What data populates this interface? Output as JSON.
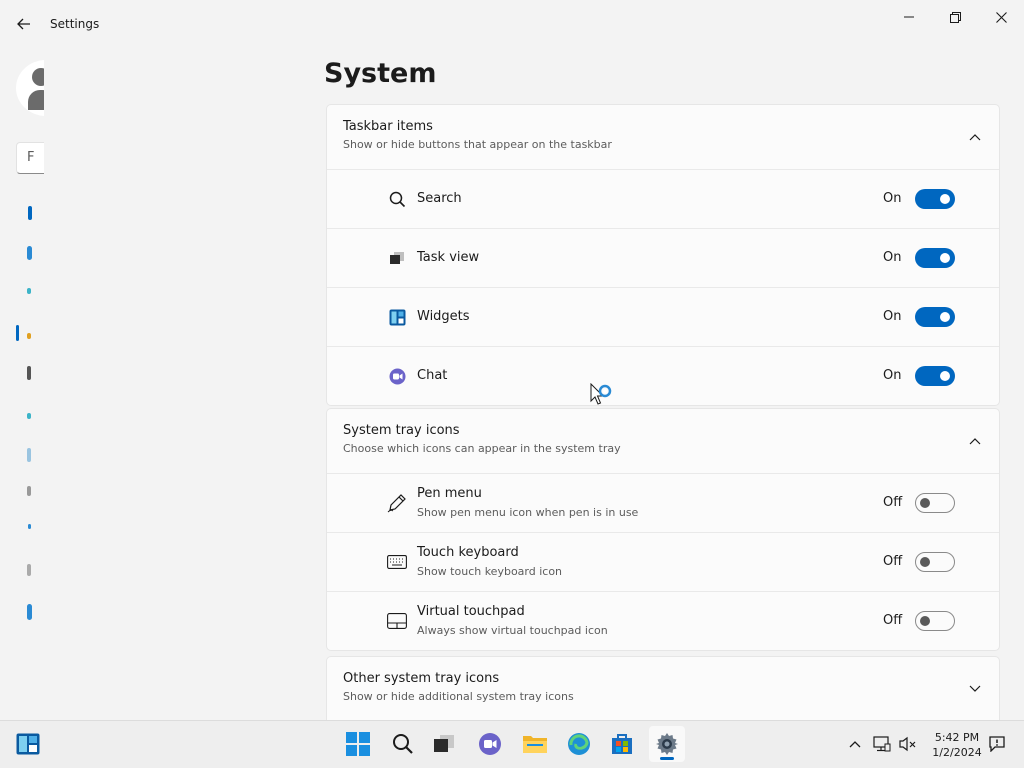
{
  "window": {
    "app_title": "Settings"
  },
  "sidebar": {
    "search_placeholder": "F"
  },
  "page": {
    "title": "System"
  },
  "sections": {
    "taskbar_items": {
      "title": "Taskbar items",
      "subtitle": "Show or hide buttons that appear on the taskbar",
      "rows": [
        {
          "icon": "search-icon",
          "label": "Search",
          "state": "On"
        },
        {
          "icon": "task-view-icon",
          "label": "Task view",
          "state": "On"
        },
        {
          "icon": "widgets-icon",
          "label": "Widgets",
          "state": "On"
        },
        {
          "icon": "chat-icon",
          "label": "Chat",
          "state": "On"
        }
      ]
    },
    "system_tray_icons": {
      "title": "System tray icons",
      "subtitle": "Choose which icons can appear in the system tray",
      "rows": [
        {
          "icon": "pen-icon",
          "label": "Pen menu",
          "description": "Show pen menu icon when pen is in use",
          "state": "Off"
        },
        {
          "icon": "keyboard-icon",
          "label": "Touch keyboard",
          "description": "Show touch keyboard icon",
          "state": "Off"
        },
        {
          "icon": "touchpad-icon",
          "label": "Virtual touchpad",
          "description": "Always show virtual touchpad icon",
          "state": "Off"
        }
      ]
    },
    "other_tray_icons": {
      "title": "Other system tray icons",
      "subtitle": "Show or hide additional system tray icons"
    }
  },
  "taskbar": {
    "clock": {
      "time": "5:42 PM",
      "date": "1/2/2024"
    }
  },
  "colors": {
    "accent": "#0067c0",
    "background": "#f3f3f3",
    "card": "#fbfbfb"
  }
}
